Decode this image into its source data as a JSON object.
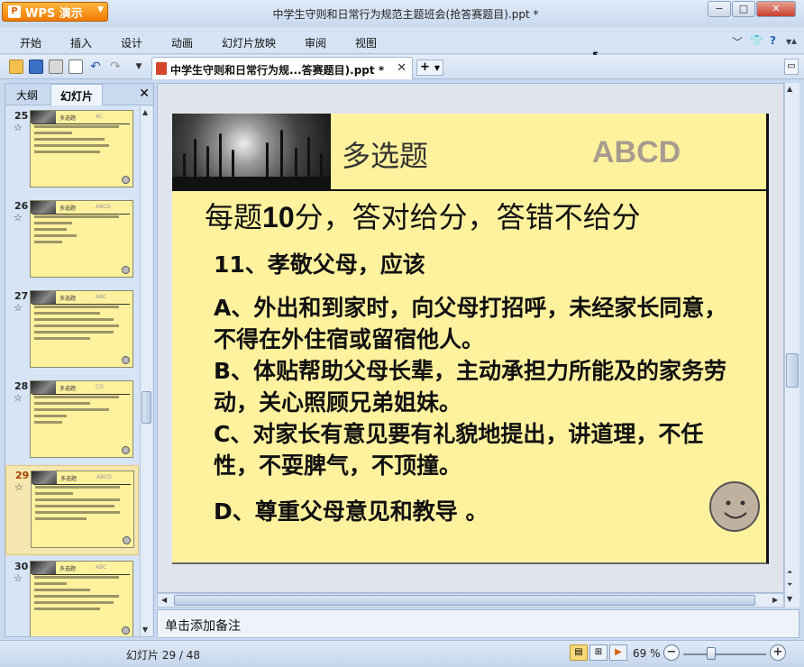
{
  "app": {
    "name": "WPS 演示",
    "window_title": "中学生守则和日常行为规范主题班会(抢答赛题目).ppt *"
  },
  "menu": {
    "items": [
      "开始",
      "插入",
      "设计",
      "动画",
      "幻灯片放映",
      "审阅",
      "视图"
    ]
  },
  "toolbar": {
    "doc_tab_label": "中学生守则和日常行为规...答赛题目).ppt *",
    "tab_add_label": "+"
  },
  "sidebar": {
    "tabs": [
      "大纲",
      "幻灯片"
    ],
    "active_tab": "幻灯片",
    "thumbnails": [
      {
        "num": "25",
        "answer": "AC",
        "title": "多选题"
      },
      {
        "num": "26",
        "answer": "ABCD",
        "title": "多选题"
      },
      {
        "num": "27",
        "answer": "ABC",
        "title": "多选题"
      },
      {
        "num": "28",
        "answer": "CD",
        "title": "多选题"
      },
      {
        "num": "29",
        "answer": "ABCD",
        "title": "多选题"
      },
      {
        "num": "30",
        "answer": "ABC",
        "title": "多选题"
      }
    ],
    "selected_slide": "29"
  },
  "slide": {
    "title": "多选题",
    "answer": "ABCD",
    "score_rule_pre": "每题",
    "score_rule_num": "10",
    "score_rule_post": "分，答对给分，答错不给分",
    "question": "11、孝敬父母，应该",
    "options": [
      "A、外出和到家时，向父母打招呼，未经家长同意，不得在外住宿或留宿他人。",
      "B、体贴帮助父母长辈，主动承担力所能及的家务劳动，关心照顾兄弟姐妹。",
      "C、对家长有意见要有礼貌地提出，讲道理，不任性，不耍脾气，不顶撞。",
      "D、尊重父母意见和教导 。"
    ]
  },
  "notes": {
    "placeholder": "单击添加备注"
  },
  "status": {
    "slide_counter": "幻灯片 29 / 48",
    "zoom_label": "69 %",
    "zoom_level": 0.69
  },
  "colors": {
    "slide_bg": "#fff29e",
    "accent": "#f07b00",
    "answer_text": "#a79c8e"
  }
}
